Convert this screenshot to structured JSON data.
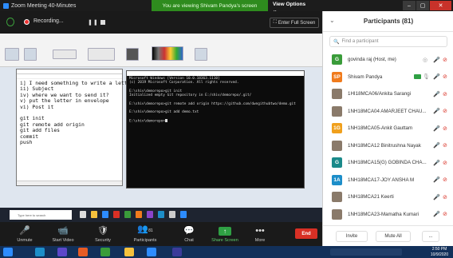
{
  "window": {
    "title": "Zoom Meeting 40-Minutes",
    "viewing_banner": "You are viewing Shivam Pandya's screen",
    "view_options": "View Options ⌄",
    "colors": {
      "banner": "#2e8b1e",
      "accent": "#2d8cff",
      "end": "#d93025",
      "share": "#2fa044"
    }
  },
  "meeting_bar": {
    "recording_label": "Recording...",
    "fullscreen_label": "Enter Full Screen"
  },
  "notepad": {
    "lines": [
      "i] I need something to write a letter",
      "ii) Subject",
      "iv) where we want to send it?",
      "v) put the letter in envelope",
      "vi) Post it",
      "",
      "git init",
      "git remote add origin",
      "git add files",
      "commit",
      "push"
    ]
  },
  "cmd": {
    "lines": [
      "Microsoft Windows [Version 10.0.18363.1110]",
      "(c) 2019 Microsoft Corporation. All rights reserved.",
      "",
      "E:\\shiv\\demorepo>git init",
      "Initialized empty Git repository in E:/shiv/demorepo/.git/",
      "",
      "E:\\shiv\\demorepo>git remote add origin https://github.com/dwngithubtwo/demo.git",
      "",
      "E:\\shiv\\demorepo>git add demo.txt",
      "",
      "E:\\shiv\\demorepo>"
    ]
  },
  "controls": {
    "unmute": "Unmute",
    "start_video": "Start Video",
    "security": "Security",
    "participants": "Participants",
    "participants_count": "81",
    "chat": "Chat",
    "share_screen": "Share Screen",
    "more": "More",
    "end": "End"
  },
  "panel": {
    "title": "Participants (81)",
    "search_placeholder": "Find a participant",
    "participants": [
      {
        "initial": "G",
        "color": "#3a9c3a",
        "name": "govinda raj (Host, me)",
        "img": false
      },
      {
        "initial": "SP",
        "color": "#f07b1d",
        "name": "Shivam Pandya",
        "img": false
      },
      {
        "initial": "",
        "color": "#8a7a6a",
        "name": "1HI18MCA06/Ankita Sarangi",
        "img": true
      },
      {
        "initial": "",
        "color": "#8a7a6a",
        "name": "1NH18MCA04 AMARJEET CHAU...",
        "img": true
      },
      {
        "initial": "1G",
        "color": "#f0a01d",
        "name": "1NH18MCA05-Ankit Gauttam",
        "img": false
      },
      {
        "initial": "",
        "color": "#8a7a6a",
        "name": "1NH18MCA12 Binitrushna Nayak",
        "img": true
      },
      {
        "initial": "G",
        "color": "#1a8a8a",
        "name": "1NH18MCA15(G) GOBINDA CHA...",
        "img": false
      },
      {
        "initial": "1A",
        "color": "#1d8ec9",
        "name": "1NH18MCA17-JOY ANSHA M",
        "img": false
      },
      {
        "initial": "",
        "color": "#8a7a6a",
        "name": "1NH18MCA21 Keerti",
        "img": true
      },
      {
        "initial": "",
        "color": "#8a7a6a",
        "name": "1NH18MCA23-Mamatha Kumari",
        "img": true
      }
    ],
    "invite": "Invite",
    "mute_all": "Mute All",
    "more": "..."
  },
  "taskbar": {
    "search_placeholder": "Type here to search",
    "time": "2:50 PM",
    "date": "10/9/2020"
  }
}
